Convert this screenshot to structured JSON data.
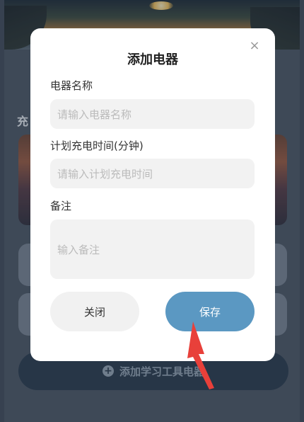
{
  "background": {
    "section_title": "充",
    "add_button_label": "添加学习工具电器"
  },
  "modal": {
    "title": "添加电器",
    "close_icon": "×",
    "fields": {
      "name_label": "电器名称",
      "name_placeholder": "请输入电器名称",
      "time_label": "计划充电时间(分钟)",
      "time_placeholder": "请输入计划充电时间",
      "note_label": "备注",
      "note_placeholder": "输入备注"
    },
    "buttons": {
      "close_label": "关闭",
      "save_label": "保存"
    }
  },
  "colors": {
    "save_button": "#5b98c2",
    "annotation_arrow": "#e8403a"
  }
}
